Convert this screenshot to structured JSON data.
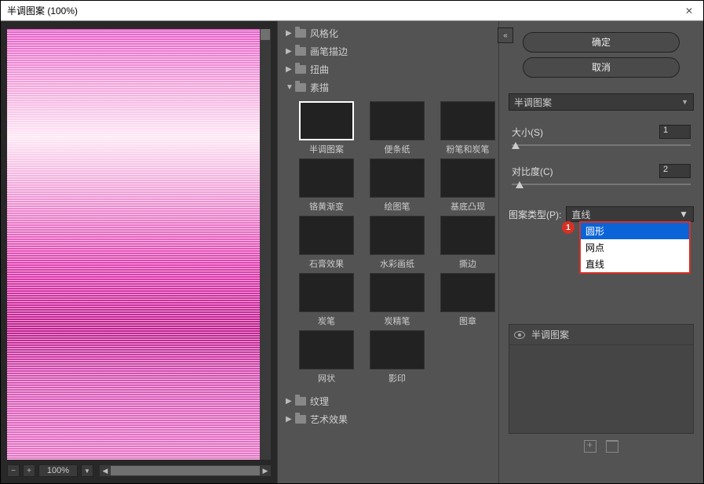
{
  "titlebar": {
    "title": "半调图案 (100%)"
  },
  "zoom": {
    "value": "100%"
  },
  "categories": {
    "stylize": "风格化",
    "brushstrokes": "画笔描边",
    "distort": "扭曲",
    "sketch": "素描",
    "texture": "纹理",
    "artistic": "艺术效果"
  },
  "thumbs": [
    {
      "label": "半调图案",
      "cls": "t-halftone",
      "selected": true
    },
    {
      "label": "便条纸",
      "cls": "t-note"
    },
    {
      "label": "粉笔和炭笔",
      "cls": "t-chalk"
    },
    {
      "label": "铬黄渐变",
      "cls": "t-chrome"
    },
    {
      "label": "绘图笔",
      "cls": "t-graphic"
    },
    {
      "label": "基底凸现",
      "cls": "t-bas"
    },
    {
      "label": "石膏效果",
      "cls": "t-plaster"
    },
    {
      "label": "水彩画纸",
      "cls": "t-water"
    },
    {
      "label": "撕边",
      "cls": "t-torn"
    },
    {
      "label": "炭笔",
      "cls": "t-charcoal"
    },
    {
      "label": "炭精笔",
      "cls": "t-conte"
    },
    {
      "label": "图章",
      "cls": "t-stamp"
    },
    {
      "label": "网状",
      "cls": "t-retic"
    },
    {
      "label": "影印",
      "cls": "t-photocopy"
    }
  ],
  "buttons": {
    "ok": "确定",
    "cancel": "取消"
  },
  "filter_select": {
    "value": "半调图案"
  },
  "params": {
    "size": {
      "label": "大小(S)",
      "value": "1",
      "pos": "0%"
    },
    "contrast": {
      "label": "对比度(C)",
      "value": "2",
      "pos": "2%"
    },
    "pattern": {
      "label": "图案类型(P):",
      "value": "直线",
      "options": [
        "圆形",
        "网点",
        "直线"
      ],
      "highlighted": "圆形",
      "badge": "1"
    }
  },
  "layer": {
    "name": "半调图案"
  }
}
